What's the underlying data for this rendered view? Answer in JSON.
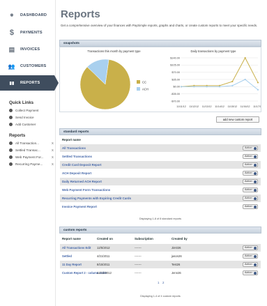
{
  "nav": [
    {
      "label": "DASHBOARD",
      "icon": "dashboard-icon",
      "glyph": "◉"
    },
    {
      "label": "PAYMENTS",
      "icon": "dollar-icon",
      "glyph": "$"
    },
    {
      "label": "INVOICES",
      "icon": "invoice-icon",
      "glyph": "▤"
    },
    {
      "label": "CUSTOMERS",
      "icon": "customers-icon",
      "glyph": "👥"
    },
    {
      "label": "REPORTS",
      "icon": "reports-icon",
      "glyph": "▮▮"
    }
  ],
  "quick_links": {
    "title": "Quick Links",
    "items": [
      "Collect Payment",
      "Send Invoice",
      "Add Customer"
    ]
  },
  "side_reports": {
    "title": "Reports",
    "items": [
      "All Transaction...",
      "Settled Transac...",
      "Web Payment For...",
      "Recurring Payme..."
    ],
    "close": "X"
  },
  "page": {
    "title": "Reports",
    "intro": "Get a comprehensive overview of your finances with PaySimple reports, graphs and charts, or create custom reports to meet your specific needs."
  },
  "snapshots": {
    "header": "snapshots",
    "pie_title": "Transactions this month by payment type",
    "pie_legend": [
      "CC",
      "ACH"
    ],
    "line_title": "Daily transactions by payment type",
    "y_ticks": [
      "$140.00",
      "$105.00",
      "$70.00",
      "$35.00",
      "$0.00",
      "-$35.00",
      "-$70.00"
    ],
    "x_ticks": [
      "11/11/12",
      "11/12/12",
      "11/13/12",
      "11/14/12",
      "11/15/12",
      "11/16/12",
      "11/17/12"
    ]
  },
  "chart_data": [
    {
      "type": "pie",
      "title": "Transactions this month by payment type",
      "categories": [
        "CC",
        "ACH"
      ],
      "values": [
        85,
        15
      ],
      "colors": [
        "#c9b04a",
        "#a9d0ee"
      ]
    },
    {
      "type": "line",
      "title": "Daily transactions by payment type",
      "x": [
        "11/11/12",
        "11/12/12",
        "11/13/12",
        "11/14/12",
        "11/15/12",
        "11/16/12",
        "11/17/12"
      ],
      "series": [
        {
          "name": "CC",
          "values": [
            0,
            5,
            5,
            5,
            25,
            140,
            20
          ],
          "color": "#c9b04a"
        },
        {
          "name": "ACH",
          "values": [
            0,
            0,
            0,
            0,
            5,
            35,
            -15
          ],
          "color": "#a9d0ee"
        }
      ],
      "ylim": [
        -70,
        140
      ]
    }
  ],
  "add_custom_report": "add new custom report",
  "standard_reports": {
    "header": "standard reports",
    "col_name": "Report name",
    "rows": [
      "All Transactions",
      "Settled Transactions",
      "Credit Card Deposit Report",
      "ACH Deposit Report",
      "Daily Returned ACH Report",
      "Web Payment Form Transactions",
      "Recurring Payments with Expiring Credit Cards",
      "Invoice Payment Report"
    ],
    "action": "Action",
    "footer": "Displaying 1-8 of 8 standard reports"
  },
  "custom_reports": {
    "header": "custom reports",
    "cols": [
      "Report name",
      "Created on",
      "Subscription",
      "Created by"
    ],
    "rows": [
      {
        "name": "All Transactions Edit",
        "created": "12/5/2012",
        "sub": "-------",
        "by": "Jim026"
      },
      {
        "name": "Settled",
        "created": "4/21/2011",
        "sub": "-------",
        "by": "jason26"
      },
      {
        "name": "11 Day Report",
        "created": "8/15/2011",
        "sub": "-------",
        "by": "Test26"
      },
      {
        "name": "Custom Report 2 - column order",
        "created": "12/13/2012",
        "sub": "-------",
        "by": "Jenn26"
      }
    ],
    "action": "Action",
    "pages": [
      "1",
      "2"
    ],
    "footer": "Displaying 1-4 of 4 custom reports"
  }
}
